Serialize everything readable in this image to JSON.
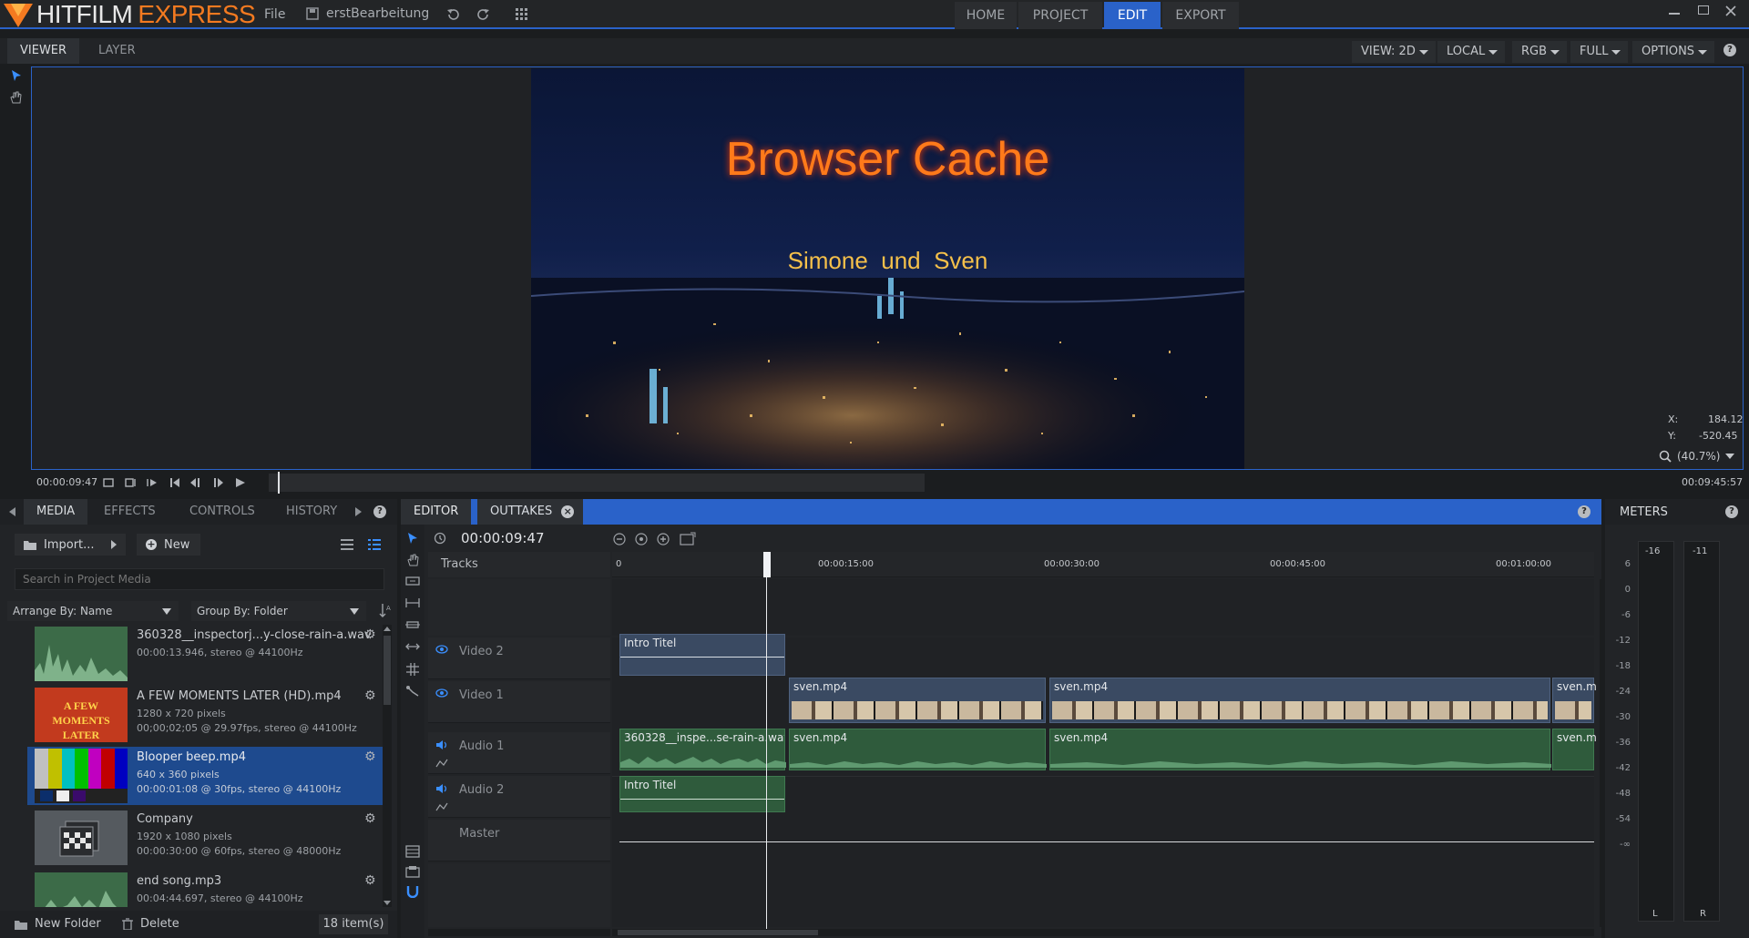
{
  "app": {
    "brand_main": "HITFILM",
    "brand_express": "EXPRESS",
    "file_menu": "File",
    "project_name": "erstBearbeitung",
    "nav_tabs": [
      "HOME",
      "PROJECT",
      "EDIT",
      "EXPORT"
    ],
    "active_nav": "EDIT",
    "accent_color": "#2a62c9"
  },
  "viewer": {
    "tabs": [
      "VIEWER",
      "LAYER"
    ],
    "options": [
      "VIEW: 2D",
      "LOCAL",
      "RGB",
      "FULL",
      "OPTIONS"
    ],
    "frame_title": "Browser Cache",
    "frame_subtitle": "Simone  und  Sven",
    "coord_x_label": "X:",
    "coord_x": "184.12",
    "coord_y_label": "Y:",
    "coord_y": "-520.45",
    "zoom": "(40.7%)",
    "current_time": "00:00:09:47",
    "duration": "00:09:45:57"
  },
  "media": {
    "tabs": [
      "MEDIA",
      "EFFECTS",
      "CONTROLS",
      "HISTORY"
    ],
    "import_label": "Import...",
    "new_label": "New",
    "search_placeholder": "Search in Project Media",
    "arrange_by": "Arrange By: Name",
    "group_by": "Group By: Folder",
    "items": [
      {
        "name": "360328__inspectorj...y-close-rain-a.wav",
        "meta1": "00:00:13.946, stereo @ 44100Hz",
        "meta2": ""
      },
      {
        "name": "A FEW MOMENTS LATER (HD).mp4",
        "meta1": "1280 x 720 pixels",
        "meta2": "00;00;02;05 @ 29.97fps, stereo @ 44100Hz"
      },
      {
        "name": "Blooper beep.mp4",
        "meta1": "640 x 360 pixels",
        "meta2": "00:00:01:08 @ 30fps, stereo @ 44100Hz"
      },
      {
        "name": "Company",
        "meta1": "1920 x 1080 pixels",
        "meta2": "00:00:30:00 @ 60fps, stereo @ 48000Hz"
      },
      {
        "name": "end song.mp3",
        "meta1": "00:04:44.697, stereo @ 44100Hz",
        "meta2": ""
      }
    ],
    "thumb_text": "A FEW MOMENTS LATER",
    "new_folder_label": "New Folder",
    "delete_label": "Delete",
    "item_count": "18 item(s)"
  },
  "editor": {
    "tabs": [
      "EDITOR",
      "OUTTAKES"
    ],
    "timecode": "00:00:09:47",
    "tracks_label": "Tracks",
    "ruler": [
      "0",
      "00:00:15:00",
      "00:00:30:00",
      "00:00:45:00",
      "00:01:00:00"
    ],
    "tracks": [
      "Video 2",
      "Video 1",
      "Audio 1",
      "Audio 2",
      "Master"
    ],
    "clips": {
      "v2_intro": "Intro Titel",
      "v1_a": "sven.mp4",
      "v1_b": "sven.mp4",
      "v1_c": "sven.m",
      "a1_rain": "360328__inspe...se-rain-a.wav",
      "a1_a": "sven.mp4",
      "a1_b": "sven.mp4",
      "a1_c": "sven.m",
      "a2_intro": "Intro Titel"
    }
  },
  "meters": {
    "title": "METERS",
    "channels_top": [
      "-16",
      "-11"
    ],
    "scale": [
      "6",
      "0",
      "-6",
      "-12",
      "-18",
      "-24",
      "-30",
      "-36",
      "-42",
      "-48",
      "-54",
      "-∞"
    ],
    "channels_bottom": [
      "L",
      "R"
    ]
  }
}
